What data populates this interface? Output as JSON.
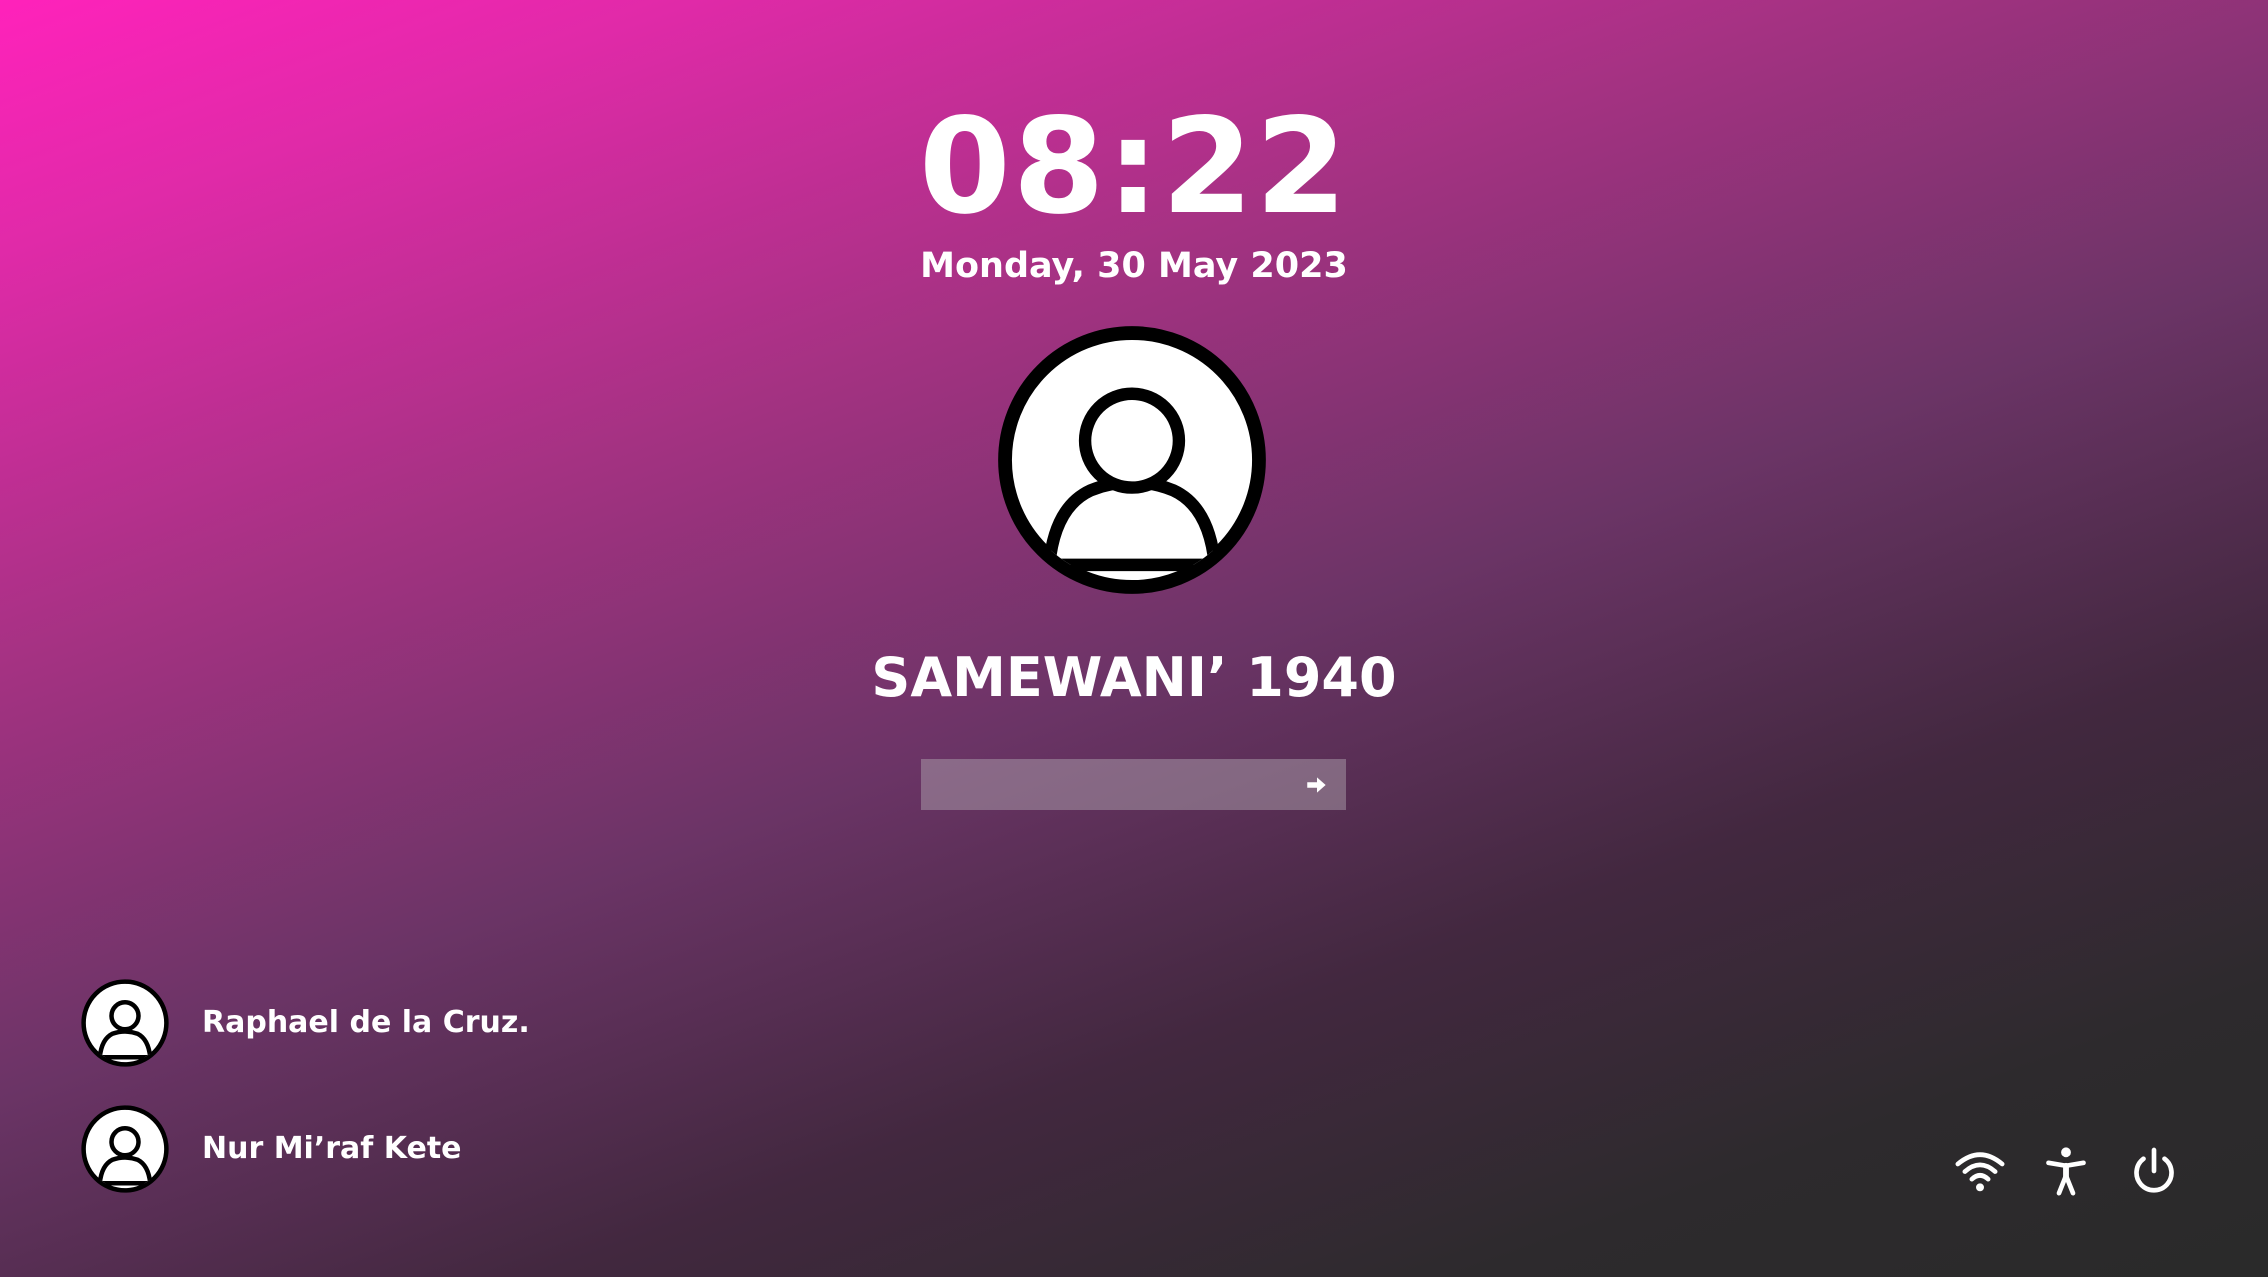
{
  "lockscreen": {
    "time": "08:22",
    "date": "Monday, 30 May 2023"
  },
  "current_user": {
    "name": "SAMEWANI’ 1940",
    "avatar_icon": "user-icon"
  },
  "password": {
    "value": "",
    "placeholder": "",
    "submit_icon": "arrow-right-icon"
  },
  "other_users": [
    {
      "name": "Raphael de la Cruz.",
      "avatar_icon": "user-icon"
    },
    {
      "name": "Nur Mi’raf Kete",
      "avatar_icon": "user-icon"
    }
  ],
  "system_tray": {
    "icons": [
      "wifi-icon",
      "accessibility-icon",
      "power-icon"
    ]
  },
  "colors": {
    "gradient_start": "#ff22bb",
    "gradient_end": "#2a2a2a",
    "text": "#ffffff",
    "input_bg": "#9a8a96"
  }
}
